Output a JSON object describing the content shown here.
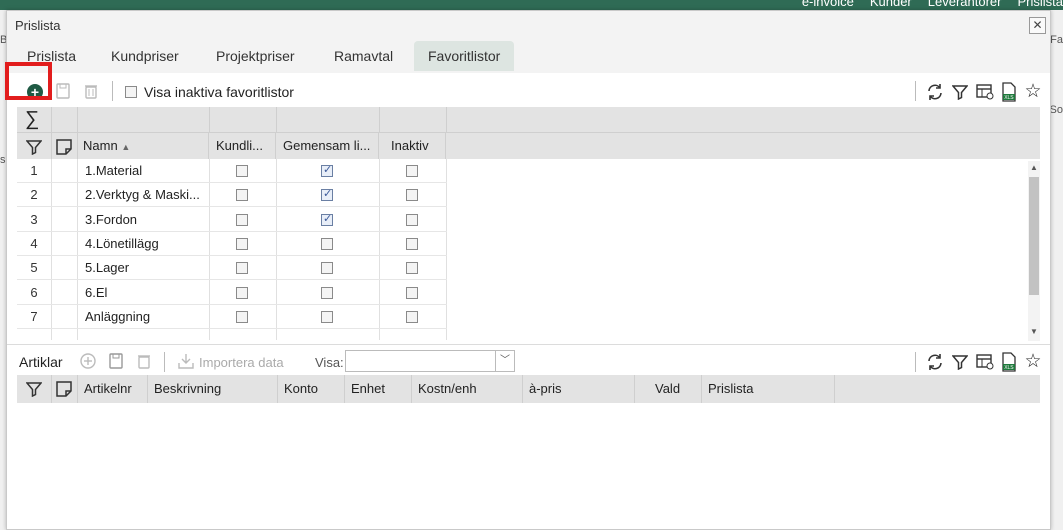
{
  "app_menu": [
    "e-invoice",
    "Kunder",
    "Leverantörer",
    "Prislista"
  ],
  "background_fragments": {
    "right": [
      "Fa",
      "So"
    ],
    "left": [
      "B",
      "sr"
    ]
  },
  "dialog": {
    "title": "Prislista",
    "close_label": "✕",
    "tabs": [
      {
        "label": "Prislista",
        "active": false
      },
      {
        "label": "Kundpriser",
        "active": false
      },
      {
        "label": "Projektpriser",
        "active": false
      },
      {
        "label": "Ramavtal",
        "active": false
      },
      {
        "label": "Favoritlistor",
        "active": true
      }
    ]
  },
  "toolbar": {
    "show_inactive_label": "Visa inaktiva favoritlistor",
    "show_inactive_checked": false
  },
  "favorites_grid": {
    "sum_symbol": "∑",
    "columns": {
      "name": "Namn",
      "name_sort": "▲",
      "customer_list": "Kundli...",
      "shared_list": "Gemensam li...",
      "inactive": "Inaktiv"
    },
    "rows": [
      {
        "num": "1",
        "name": "1.Material",
        "customer": false,
        "shared": true,
        "inactive": false
      },
      {
        "num": "2",
        "name": "2.Verktyg & Maski...",
        "customer": false,
        "shared": true,
        "inactive": false
      },
      {
        "num": "3",
        "name": "3.Fordon",
        "customer": false,
        "shared": true,
        "inactive": false
      },
      {
        "num": "4",
        "name": "4.Lönetillägg",
        "customer": false,
        "shared": false,
        "inactive": false
      },
      {
        "num": "5",
        "name": "5.Lager",
        "customer": false,
        "shared": false,
        "inactive": false
      },
      {
        "num": "6",
        "name": "6.El",
        "customer": false,
        "shared": false,
        "inactive": false
      },
      {
        "num": "7",
        "name": "Anläggning",
        "customer": false,
        "shared": false,
        "inactive": false
      }
    ]
  },
  "articles": {
    "title": "Artiklar",
    "import_label": "Importera data",
    "show_label": "Visa:",
    "show_value": "",
    "columns": [
      "Artikelnr",
      "Beskrivning",
      "Konto",
      "Enhet",
      "Kostn/enh",
      "à-pris",
      "Vald",
      "Prislista"
    ]
  }
}
